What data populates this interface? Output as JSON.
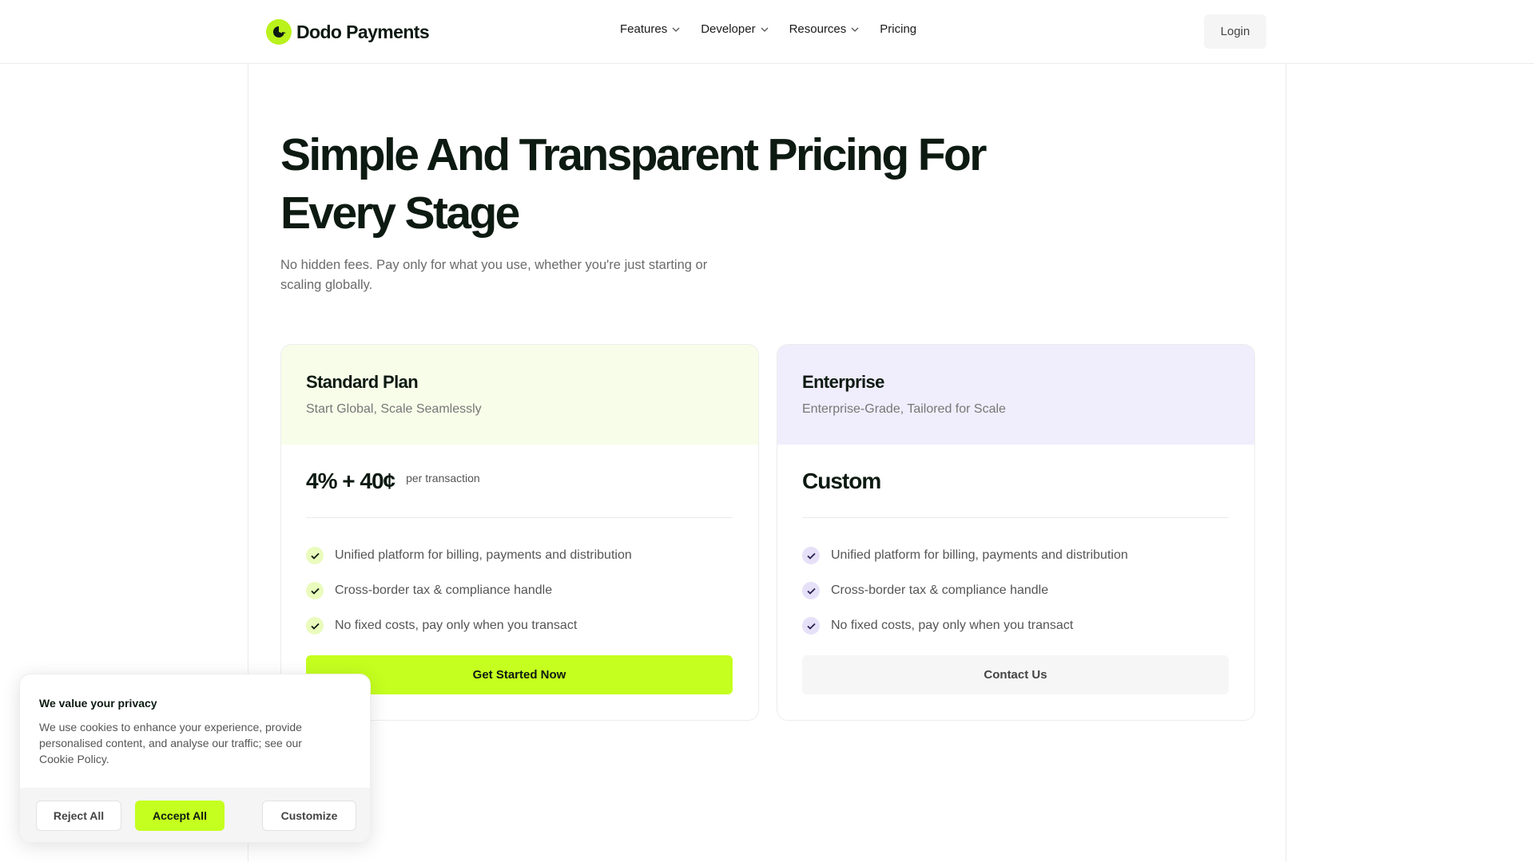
{
  "brand": {
    "name": "Dodo Payments",
    "accent": "#c5ff1f",
    "logo_icon": "dodo-bird-icon"
  },
  "nav": {
    "items": [
      {
        "label": "Features",
        "has_dropdown": true
      },
      {
        "label": "Developer",
        "has_dropdown": true
      },
      {
        "label": "Resources",
        "has_dropdown": true
      },
      {
        "label": "Pricing",
        "has_dropdown": false
      }
    ],
    "login_label": "Login"
  },
  "hero": {
    "title": "Simple And Transparent Pricing For Every Stage",
    "subtitle": "No hidden fees. Pay only for what you use, whether you're just starting or scaling globally."
  },
  "plans": [
    {
      "name": "Standard Plan",
      "tagline": "Start Global, Scale Seamlessly",
      "price": "4% + 40¢",
      "price_unit": "per transaction",
      "features": [
        "Unified platform for billing, payments and distribution",
        "Cross-border tax & compliance handle",
        "No fixed costs, pay only when you transact"
      ],
      "cta": "Get Started Now",
      "header_color": "#f8fde9"
    },
    {
      "name": "Enterprise",
      "tagline": "Enterprise-Grade, Tailored for Scale",
      "price": "Custom",
      "price_unit": "",
      "features": [
        "Unified platform for billing, payments and distribution",
        "Cross-border tax & compliance handle",
        "No fixed costs, pay only when you transact"
      ],
      "cta": "Contact Us",
      "header_color": "#f0edfc"
    }
  ],
  "cookie": {
    "title": "We value your privacy",
    "text": "We use cookies to enhance your experience, provide personalised content, and analyse our traffic; see our Cookie Policy.",
    "reject_label": "Reject All",
    "accept_label": "Accept All",
    "customize_label": "Customize"
  }
}
